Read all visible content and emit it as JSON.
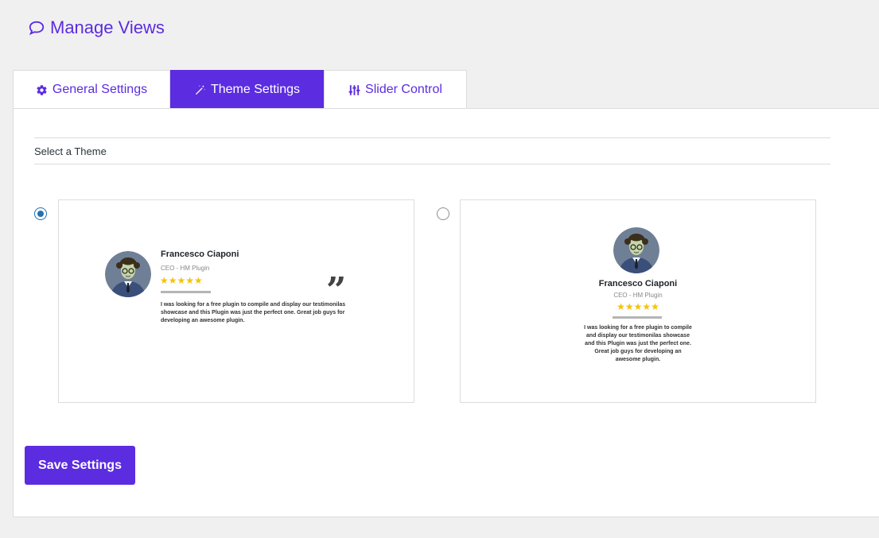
{
  "header": {
    "title": "Manage Views",
    "icon": "speech-bubble-icon"
  },
  "tabs": [
    {
      "label": "General Settings",
      "icon": "gear-icon",
      "active": false
    },
    {
      "label": "Theme Settings",
      "icon": "magic-wand-icon",
      "active": true
    },
    {
      "label": "Slider Control",
      "icon": "sliders-icon",
      "active": false
    }
  ],
  "theme_section": {
    "label": "Select a Theme"
  },
  "themes": [
    {
      "selected": true,
      "preview": {
        "name": "Francesco Ciaponi",
        "role": "CEO - HM Plugin",
        "stars": "★★★★★",
        "rating": 5,
        "text": "I was looking for a free plugin to compile and display our testimonilas showcase and this Plugin was just the perfect one. Great job guys for developing an awesome plugin.",
        "quote_mark": "”"
      }
    },
    {
      "selected": false,
      "preview": {
        "name": "Francesco Ciaponi",
        "role": "CEO - HM Plugin",
        "stars": "★★★★★",
        "rating": 5,
        "text": "I was looking for a free plugin to compile and display our testimonilas showcase and this Plugin was just the perfect one. Great job guys for developing an awesome plugin."
      }
    }
  ],
  "actions": {
    "save_label": "Save Settings"
  },
  "colors": {
    "accent": "#5b2ce0",
    "star": "#f4c20d",
    "radio_selected": "#2271b1"
  }
}
